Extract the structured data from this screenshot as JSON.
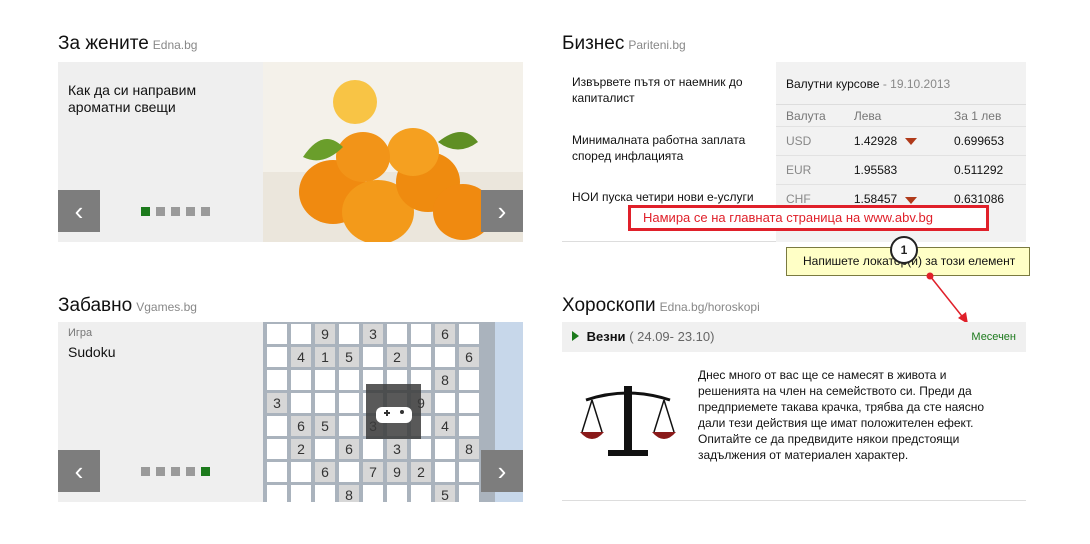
{
  "women": {
    "title": "За жените",
    "source": "Edna.bg",
    "article": "Как да си направим ароматни свещи"
  },
  "fun": {
    "title": "Забавно",
    "source": "Vgames.bg",
    "category": "Игра",
    "game": "Sudoku"
  },
  "business": {
    "title": "Бизнес",
    "source": "Pariteni.bg",
    "news": [
      "Извървете пътя от наемник до капиталист",
      "Минималната работна заплата според инфлацията",
      "НОИ пуска четири нови е-услуги"
    ],
    "rates_label": "Валутни курсове",
    "rates_date": "- 19.10.2013",
    "columns": [
      "Валута",
      "Лева",
      "За 1 лев"
    ],
    "rows": [
      {
        "cur": "USD",
        "lev": "1.42928",
        "per": "0.699653",
        "down": true
      },
      {
        "cur": "EUR",
        "lev": "1.95583",
        "per": "0.511292",
        "down": false
      },
      {
        "cur": "CHF",
        "lev": "1.58457",
        "per": "0.631086",
        "down": true
      }
    ]
  },
  "horoscope": {
    "title": "Хороскопи",
    "source": "Edna.bg/horoskopi",
    "sign": "Везни",
    "dates": "( 24.09- 23.10)",
    "link": "Месечен",
    "text": "Днес много от вас ще се намесят в живота и решенията на член на семейството си. Преди да предприемете такава крачка, трябва да сте наясно дали тези действия ще имат положителен ефект. Опитайте се да предвидите някои предстоящи задължения от материален характер."
  },
  "annotation": {
    "location": "Намира се на главната страница на www.abv.bg",
    "tooltip": "Напишете локатор(и) за този елемент",
    "badge": "1"
  },
  "colors": {
    "accent": "#1c7a1c",
    "annotation": "#e0202a"
  }
}
